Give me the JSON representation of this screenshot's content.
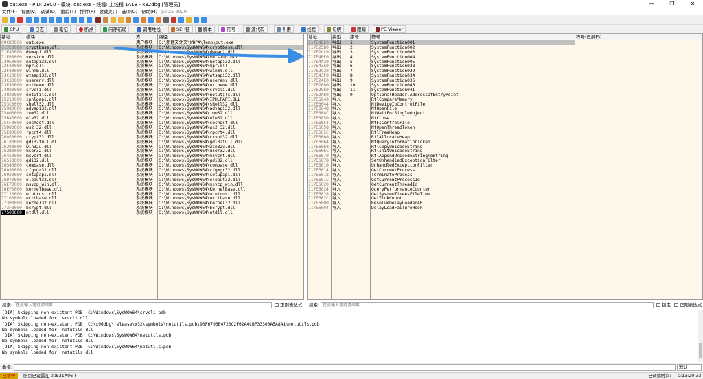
{
  "titlebar": {
    "title": "out.exe - PID: 28C0 - 模块: out.exe - 线程: 主线程 1A18 - x32dbg [管理员]",
    "minimize": "—",
    "maximize": "❐",
    "close": "✕"
  },
  "menu": {
    "items": [
      "文件(F)",
      "视图(V)",
      "调试(D)",
      "追踪(T)",
      "插件(P)",
      "收藏夹(I)",
      "选项(O)",
      "帮助(H)"
    ],
    "date": "Jul 25 2020"
  },
  "tabs": [
    {
      "label": "CPU",
      "color": "#3a8a3a"
    },
    {
      "label": "日志",
      "color": "#5577cc"
    },
    {
      "label": "笔记",
      "color": "#888888"
    },
    {
      "label": "断点",
      "color": "#cc2222"
    },
    {
      "label": "内存布局",
      "color": "#229944"
    },
    {
      "label": "调用堆栈",
      "color": "#3366cc"
    },
    {
      "label": "SEH链",
      "color": "#cc6622"
    },
    {
      "label": "脚本",
      "color": "#666666"
    },
    {
      "label": "符号",
      "color": "#aa44cc"
    },
    {
      "label": "源代码",
      "color": "#777777"
    },
    {
      "label": "引用",
      "color": "#6688aa"
    },
    {
      "label": "线程",
      "color": "#3377cc"
    },
    {
      "label": "句柄",
      "color": "#888833"
    },
    {
      "label": "跟踪",
      "color": "#cc3333"
    },
    {
      "label": "PE Viewer",
      "color": "#882222"
    }
  ],
  "modules": {
    "headers": {
      "base": "基址",
      "module": "模块",
      "party": "方",
      "path": "路径"
    },
    "rows": [
      {
        "base": "00CD0000",
        "name": "out.exe",
        "party": "用户模块",
        "path": "C:\\新建文件夹\\WDPA\\Temp\\out.exe"
      },
      {
        "base": "717E0000",
        "name": "cryptbase.dll",
        "party": "系统模块",
        "path": "C:\\Windows\\SysWOW64\\cryptbase.dll"
      },
      {
        "base": "71EA0000",
        "name": "dwmapi.dll",
        "party": "系统模块",
        "path": "C:\\Windows\\SysWOW64\\dwmapi.dll"
      },
      {
        "base": "71EB0000",
        "name": "version.dll",
        "party": "系统模块",
        "path": "C:\\Windows\\SysWOW64\\version.dll"
      },
      {
        "base": "729E0000",
        "name": "netapi32.dll",
        "party": "系统模块",
        "path": "C:\\Windows\\SysWOW64\\netapi32.dll"
      },
      {
        "base": "72F20000",
        "name": "mpr.dll",
        "party": "系统模块",
        "path": "C:\\Windows\\SysWOW64\\mpr.dll"
      },
      {
        "base": "72F80000",
        "name": "winmm.dll",
        "party": "系统模块",
        "path": "C:\\Windows\\SysWOW64\\winmm.dll"
      },
      {
        "base": "73C10000",
        "name": "wtsapi32.dll",
        "party": "系统模块",
        "path": "C:\\Windows\\SysWOW64\\wtsapi32.dll"
      },
      {
        "base": "73C30000",
        "name": "userenv.dll",
        "party": "系统模块",
        "path": "C:\\Windows\\SysWOW64\\userenv.dll"
      },
      {
        "base": "73E80000",
        "name": "uxtheme.dll",
        "party": "系统模块",
        "path": "C:\\Windows\\SysWOW64\\uxtheme.dll"
      },
      {
        "base": "74800000",
        "name": "srvcli.dll",
        "party": "系统模块",
        "path": "C:\\Windows\\SysWOW64\\srvcli.dll"
      },
      {
        "base": "74820000",
        "name": "netutils.dll",
        "party": "系统模块",
        "path": "C:\\Windows\\SysWOW64\\netutils.dll"
      },
      {
        "base": "75210000",
        "name": "iphlpapi.dll",
        "party": "系统模块",
        "path": "C:\\Windows\\SysWOW64\\IPHLPAPI.DLL"
      },
      {
        "base": "753C0000",
        "name": "shell32.dll",
        "party": "系统模块",
        "path": "C:\\Windows\\SysWOW64\\shell32.dll"
      },
      {
        "base": "75980000",
        "name": "advapi32.dll",
        "party": "系统模块",
        "path": "C:\\Windows\\SysWOW64\\advapi32.dll"
      },
      {
        "base": "75A00000",
        "name": "imm32.dll",
        "party": "系统模块",
        "path": "C:\\Windows\\SysWOW64\\imm32.dll"
      },
      {
        "base": "75BA0000",
        "name": "ole32.dll",
        "party": "系统模块",
        "path": "C:\\Windows\\SysWOW64\\ole32.dll"
      },
      {
        "base": "75CF0000",
        "name": "sechost.dll",
        "party": "系统模块",
        "path": "C:\\Windows\\SysWOW64\\sechost.dll"
      },
      {
        "base": "75D80000",
        "name": "ws2_32.dll",
        "party": "系统模块",
        "path": "C:\\Windows\\SysWOW64\\ws2_32.dll"
      },
      {
        "base": "75E80000",
        "name": "rpcrt4.dll",
        "party": "系统模块",
        "path": "C:\\Windows\\SysWOW64\\rpcrt4.dll"
      },
      {
        "base": "76050000",
        "name": "crypt32.dll",
        "party": "系统模块",
        "path": "C:\\Windows\\SysWOW64\\crypt32.dll"
      },
      {
        "base": "76180000",
        "name": "gdi32full.dll",
        "party": "系统模块",
        "path": "C:\\Windows\\SysWOW64\\gdi32full.dll"
      },
      {
        "base": "76290000",
        "name": "win32u.dll",
        "party": "系统模块",
        "path": "C:\\Windows\\SysWOW64\\win32u.dll"
      },
      {
        "base": "762B0000",
        "name": "user32.dll",
        "party": "系统模块",
        "path": "C:\\Windows\\SysWOW64\\user32.dll"
      },
      {
        "base": "76450000",
        "name": "msvcrt.dll",
        "party": "系统模块",
        "path": "C:\\Windows\\SysWOW64\\msvcrt.dll"
      },
      {
        "base": "76510000",
        "name": "gdi32.dll",
        "party": "系统模块",
        "path": "C:\\Windows\\SysWOW64\\gdi32.dll"
      },
      {
        "base": "76540000",
        "name": "combase.dll",
        "party": "系统模块",
        "path": "C:\\Windows\\SysWOW64\\combase.dll"
      },
      {
        "base": "76890000",
        "name": "cfgmgr32.dll",
        "party": "系统模块",
        "path": "C:\\Windows\\SysWOW64\\cfgmgr32.dll"
      },
      {
        "base": "76930000",
        "name": "setupapi.dll",
        "party": "系统模块",
        "path": "C:\\Windows\\SysWOW64\\setupapi.dll"
      },
      {
        "base": "76D70000",
        "name": "oleaut32.dll",
        "party": "系统模块",
        "path": "C:\\Windows\\SysWOW64\\oleaut32.dll"
      },
      {
        "base": "76E70000",
        "name": "msvcp_win.dll",
        "party": "系统模块",
        "path": "C:\\Windows\\SysWOW64\\msvcp_win.dll"
      },
      {
        "base": "76EF0000",
        "name": "kernelbase.dll",
        "party": "系统模块",
        "path": "C:\\Windows\\SysWOW64\\KernelBase.dll"
      },
      {
        "base": "77110000",
        "name": "wintrust.dll",
        "party": "系统模块",
        "path": "C:\\Windows\\SysWOW64\\wintrust.dll"
      },
      {
        "base": "77160000",
        "name": "ucrtbase.dll",
        "party": "系统模块",
        "path": "C:\\Windows\\SysWOW64\\ucrtbase.dll"
      },
      {
        "base": "77300000",
        "name": "kernel32.dll",
        "party": "系统模块",
        "path": "C:\\Windows\\SysWOW64\\kernel32.dll"
      },
      {
        "base": "773F0000",
        "name": "bcrypt.dll",
        "party": "系统模块",
        "path": "C:\\Windows\\SysWOW64\\bcrypt.dll"
      },
      {
        "base": "77500000",
        "name": "ntdll.dll",
        "party": "系统模块",
        "path": "C:\\Windows\\SysWOW64\\ntdll.dll"
      }
    ]
  },
  "symbols": {
    "headers": {
      "addr": "地址",
      "type": "类型",
      "ord": "序号",
      "sym": "符号",
      "undec": "符号(已解码)"
    },
    "rows": [
      {
        "addr": "717E4BE0",
        "type": "导出",
        "ord": "1",
        "sym": "SystemFunction001"
      },
      {
        "addr": "717E25B0",
        "type": "导出",
        "ord": "2",
        "sym": "SystemFunction002"
      },
      {
        "addr": "717E2CC0",
        "type": "导出",
        "ord": "3",
        "sym": "SystemFunction003"
      },
      {
        "addr": "717E4BE0",
        "type": "导出",
        "ord": "4",
        "sym": "SystemFunction004"
      },
      {
        "addr": "717E4A20",
        "type": "导出",
        "ord": "5",
        "sym": "SystemFunction005"
      },
      {
        "addr": "717E43A0",
        "type": "导出",
        "ord": "6",
        "sym": "SystemFunction028"
      },
      {
        "addr": "717E2C20",
        "type": "导出",
        "ord": "7",
        "sym": "SystemFunction029"
      },
      {
        "addr": "717E43F0",
        "type": "导出",
        "ord": "8",
        "sym": "SystemFunction034"
      },
      {
        "addr": "717E24E0",
        "type": "导出",
        "ord": "9",
        "sym": "SystemFunction036"
      },
      {
        "addr": "717E2880",
        "type": "导出",
        "ord": "10",
        "sym": "SystemFunction040"
      },
      {
        "addr": "717E28E0",
        "type": "导出",
        "ord": "11",
        "sym": "SystemFunction041"
      },
      {
        "addr": "717E2A60",
        "type": "导出",
        "ord": "0",
        "sym": "OptionalHeader.AddressOfEntryPoint"
      },
      {
        "addr": "717E6040",
        "type": "导入",
        "ord": "",
        "sym": "RtlCompareMemory"
      },
      {
        "addr": "717E6044",
        "type": "导入",
        "ord": "",
        "sym": "NtDeviceIoControlFile"
      },
      {
        "addr": "717E6048",
        "type": "导入",
        "ord": "",
        "sym": "NtOpenFile"
      },
      {
        "addr": "717E604C",
        "type": "导入",
        "ord": "",
        "sym": "NtWaitForSingleObject"
      },
      {
        "addr": "717E6050",
        "type": "导入",
        "ord": "",
        "sym": "NtClose"
      },
      {
        "addr": "717E6054",
        "type": "导入",
        "ord": "",
        "sym": "NtFsControlFile"
      },
      {
        "addr": "717E6058",
        "type": "导入",
        "ord": "",
        "sym": "NtOpenThreadToken"
      },
      {
        "addr": "717E605C",
        "type": "导入",
        "ord": "",
        "sym": "RtlFreeHeap"
      },
      {
        "addr": "717E6060",
        "type": "导入",
        "ord": "",
        "sym": "RtlAllocateHeap"
      },
      {
        "addr": "717E6064",
        "type": "导入",
        "ord": "",
        "sym": "NtQueryInformationToken"
      },
      {
        "addr": "717E6068",
        "type": "导入",
        "ord": "",
        "sym": "RtlCopyUnicodeString"
      },
      {
        "addr": "717E606C",
        "type": "导入",
        "ord": "",
        "sym": "RtlInitUnicodeString"
      },
      {
        "addr": "717E6070",
        "type": "导入",
        "ord": "",
        "sym": "RtlAppendUnicodeStringToString"
      },
      {
        "addr": "717E6078",
        "type": "导入",
        "ord": "",
        "sym": "SetUnhandledExceptionFilter"
      },
      {
        "addr": "717E6010",
        "type": "导入",
        "ord": "",
        "sym": "UnhandledExceptionFilter"
      },
      {
        "addr": "717E6014",
        "type": "导入",
        "ord": "",
        "sym": "GetCurrentProcess"
      },
      {
        "addr": "717E6018",
        "type": "导入",
        "ord": "",
        "sym": "TerminateProcess"
      },
      {
        "addr": "717E601C",
        "type": "导入",
        "ord": "",
        "sym": "GetCurrentProcessId"
      },
      {
        "addr": "717E6020",
        "type": "导入",
        "ord": "",
        "sym": "GetCurrentThreadId"
      },
      {
        "addr": "717E6024",
        "type": "导入",
        "ord": "",
        "sym": "QueryPerformanceCounter"
      },
      {
        "addr": "717E6028",
        "type": "导入",
        "ord": "",
        "sym": "GetSystemTimeAsFileTime"
      },
      {
        "addr": "717E602C",
        "type": "导入",
        "ord": "",
        "sym": "GetTickCount"
      },
      {
        "addr": "717E6000",
        "type": "导入",
        "ord": "",
        "sym": "ResolveDelayLoadedAPI"
      },
      {
        "addr": "717E6004",
        "type": "导入",
        "ord": "",
        "sym": "DelayLoadFailureHook"
      }
    ]
  },
  "search": {
    "left_label": "搜索:",
    "left_placeholder": "在此输入可过滤结果",
    "left_regex": "正则表达式",
    "right_label": "搜索:",
    "right_placeholder": "在此输入可过滤结果",
    "lock": "锁定",
    "right_regex": "正则表达式"
  },
  "log": [
    "[DIA] Skipping non-existent PDB: C:\\Windows\\SysWOW64\\srvcli.pdb",
    "No symbols loaded for: srvcli.dll",
    "[DIA] Skipping non-existent PDB: C:\\x96dbg\\release\\x32\\symbols\\netutils.pdb\\90F6793E4720C2F62A4CBF33303A5A8A1\\netutils.pdb",
    "No symbols loaded for: netutils.dll",
    "[DIA] Skipping non-existent PDB: C:\\Windows\\SysWOW64\\netutils.pdb",
    "No symbols loaded for: netutils.dll",
    "[DIA] Skipping non-existent PDB: C:\\Windows\\SysWOW64\\netutils.pdb",
    "No symbols loaded for: netutils.dll"
  ],
  "cmd": {
    "label": "命令:",
    "mode": "默认"
  },
  "status": {
    "state": "已暂停",
    "message": "断点已设置在 00E31A06 !",
    "elapsed_label": "已调试时间:",
    "elapsed": "0:13:20:33"
  },
  "colors": {
    "accent": "#3a8ee6",
    "paused": "#d4a800"
  }
}
